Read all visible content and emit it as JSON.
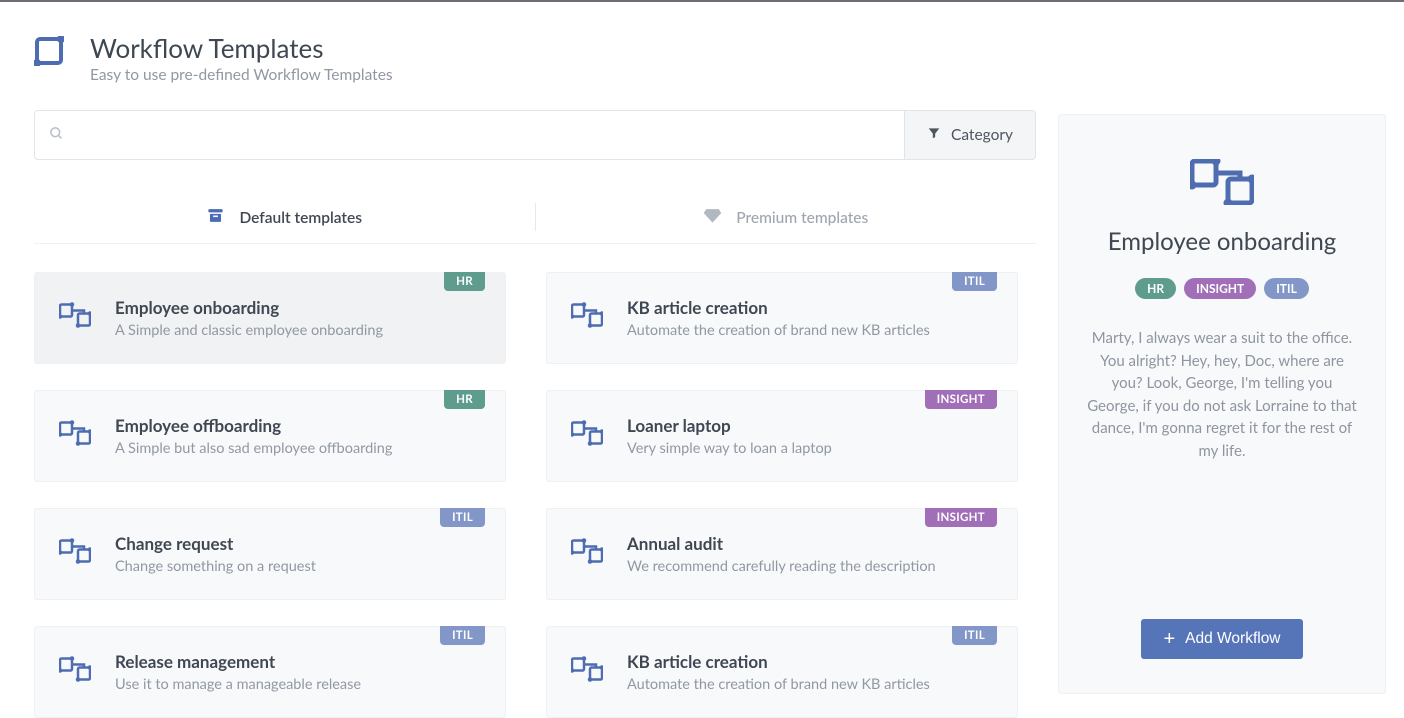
{
  "header": {
    "title": "Workflow Templates",
    "subtitle": "Easy to use pre-defined Workflow Templates"
  },
  "search": {
    "placeholder": "",
    "category_label": "Category"
  },
  "tabs": {
    "default": "Default templates",
    "premium": "Premium templates"
  },
  "tag_labels": {
    "hr": "HR",
    "itil": "ITIL",
    "insight": "INSIGHT"
  },
  "cards": [
    {
      "title": "Employee onboarding",
      "desc": "A Simple and classic employee onboarding",
      "tag": "hr",
      "selected": true
    },
    {
      "title": "KB article creation",
      "desc": "Automate the creation of brand new KB articles",
      "tag": "itil",
      "selected": false
    },
    {
      "title": "Employee offboarding",
      "desc": "A Simple but also sad employee offboarding",
      "tag": "hr",
      "selected": false
    },
    {
      "title": "Loaner laptop",
      "desc": "Very simple way to loan a laptop",
      "tag": "insight",
      "selected": false
    },
    {
      "title": "Change request",
      "desc": "Change something on a request",
      "tag": "itil",
      "selected": false
    },
    {
      "title": "Annual audit",
      "desc": "We recommend carefully reading the description",
      "tag": "insight",
      "selected": false
    },
    {
      "title": "Release management",
      "desc": "Use it to manage a manageable release",
      "tag": "itil",
      "selected": false
    },
    {
      "title": "KB article creation",
      "desc": "Automate the creation of brand new KB articles",
      "tag": "itil",
      "selected": false
    }
  ],
  "panel": {
    "title": "Employee onboarding",
    "pills": [
      "hr",
      "insight",
      "itil"
    ],
    "desc": "Marty, I always wear a suit to the office. You alright? Hey, hey, Doc, where are you? Look, George, I'm telling you George, if you do not ask Lorraine to that dance, I'm gonna regret it for the rest of my life.",
    "button": "Add Workflow"
  }
}
